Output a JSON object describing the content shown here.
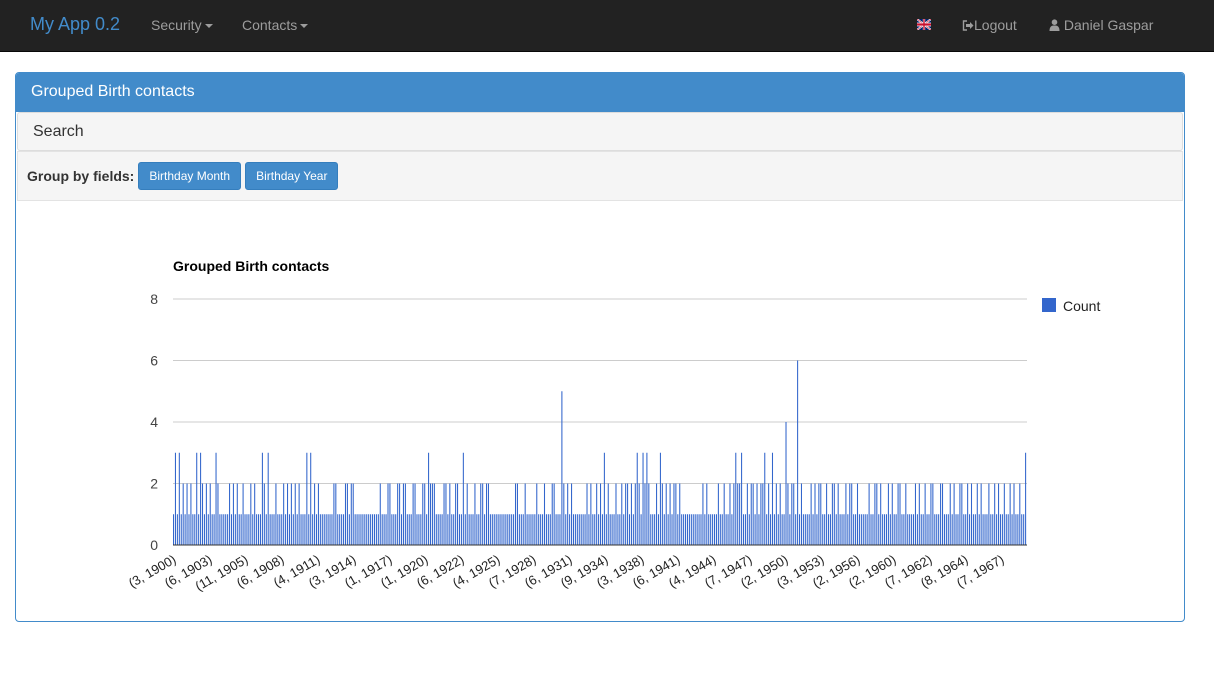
{
  "navbar": {
    "brand": "My App 0.2",
    "menus": [
      {
        "label": "Security"
      },
      {
        "label": "Contacts"
      }
    ],
    "language_icon": "uk-flag-icon",
    "logout_label": "Logout",
    "user_label": "Daniel Gaspar"
  },
  "panel": {
    "title": "Grouped Birth contacts",
    "search_label": "Search",
    "group_by_label": "Group by fields:",
    "group_buttons": [
      {
        "label": "Birthday Month"
      },
      {
        "label": "Birthday Year"
      }
    ]
  },
  "chart_data": {
    "type": "bar",
    "title": "Grouped Birth contacts",
    "xlabel": "",
    "ylabel": "",
    "ylim": [
      0,
      8
    ],
    "yticks": [
      0,
      2,
      4,
      6,
      8
    ],
    "grid": true,
    "legend_position": "right",
    "bar_color": "#3366cc",
    "series": [
      {
        "name": "Count",
        "color": "#3366cc"
      }
    ],
    "xtick_labels": [
      "(3, 1900)",
      "(6, 1903)",
      "(11, 1905)",
      "(6, 1908)",
      "(4, 1911)",
      "(3, 1914)",
      "(1, 1917)",
      "(1, 1920)",
      "(6, 1922)",
      "(4, 1925)",
      "(7, 1928)",
      "(6, 1931)",
      "(9, 1934)",
      "(3, 1938)",
      "(6, 1941)",
      "(4, 1944)",
      "(7, 1947)",
      "(2, 1950)",
      "(3, 1953)",
      "(2, 1956)",
      "(2, 1960)",
      "(7, 1962)",
      "(8, 1964)",
      "(7, 1967)"
    ],
    "values": [
      1,
      3,
      1,
      3,
      1,
      2,
      1,
      2,
      1,
      2,
      1,
      1,
      3,
      1,
      3,
      2,
      1,
      2,
      1,
      2,
      1,
      1,
      3,
      2,
      1,
      1,
      1,
      1,
      1,
      2,
      1,
      2,
      1,
      2,
      1,
      1,
      2,
      1,
      1,
      1,
      2,
      1,
      2,
      1,
      1,
      1,
      3,
      2,
      1,
      3,
      1,
      1,
      1,
      2,
      1,
      1,
      1,
      2,
      1,
      2,
      1,
      2,
      1,
      2,
      1,
      2,
      1,
      1,
      1,
      3,
      1,
      3,
      1,
      2,
      1,
      2,
      1,
      1,
      1,
      1,
      1,
      1,
      1,
      2,
      2,
      1,
      1,
      1,
      1,
      2,
      2,
      1,
      2,
      2,
      1,
      1,
      1,
      1,
      1,
      1,
      1,
      1,
      1,
      1,
      1,
      1,
      1,
      2,
      1,
      1,
      1,
      2,
      2,
      1,
      1,
      1,
      2,
      2,
      1,
      2,
      2,
      1,
      1,
      1,
      2,
      2,
      1,
      1,
      1,
      2,
      2,
      1,
      3,
      2,
      2,
      2,
      1,
      1,
      1,
      1,
      2,
      2,
      1,
      2,
      1,
      1,
      2,
      2,
      1,
      1,
      3,
      1,
      2,
      1,
      1,
      1,
      2,
      1,
      1,
      2,
      2,
      1,
      2,
      2,
      1,
      1,
      1,
      1,
      1,
      1,
      1,
      1,
      1,
      1,
      1,
      1,
      1,
      2,
      2,
      1,
      1,
      1,
      2,
      1,
      1,
      1,
      1,
      1,
      2,
      1,
      1,
      1,
      2,
      1,
      1,
      1,
      2,
      2,
      1,
      1,
      1,
      5,
      2,
      1,
      2,
      1,
      2,
      1,
      1,
      1,
      1,
      1,
      1,
      1,
      2,
      1,
      2,
      1,
      1,
      2,
      1,
      2,
      1,
      3,
      1,
      2,
      1,
      1,
      1,
      2,
      1,
      1,
      2,
      1,
      2,
      2,
      1,
      2,
      1,
      2,
      3,
      2,
      1,
      3,
      2,
      3,
      2,
      1,
      1,
      1,
      2,
      1,
      3,
      2,
      1,
      2,
      1,
      2,
      1,
      2,
      2,
      1,
      2,
      1,
      1,
      1,
      1,
      1,
      1,
      1,
      1,
      1,
      1,
      1,
      2,
      1,
      2,
      1,
      1,
      1,
      1,
      1,
      2,
      1,
      1,
      2,
      1,
      1,
      2,
      1,
      2,
      3,
      2,
      2,
      3,
      1,
      1,
      2,
      1,
      2,
      2,
      1,
      2,
      1,
      2,
      2,
      3,
      1,
      2,
      1,
      3,
      1,
      2,
      1,
      2,
      1,
      1,
      4,
      2,
      1,
      2,
      2,
      1,
      6,
      1,
      2,
      1,
      1,
      1,
      1,
      2,
      1,
      2,
      1,
      2,
      2,
      1,
      1,
      2,
      1,
      1,
      2,
      2,
      1,
      2,
      1,
      1,
      1,
      2,
      1,
      2,
      2,
      1,
      1,
      2,
      1,
      1,
      1,
      1,
      1,
      2,
      1,
      1,
      2,
      2,
      1,
      2,
      1,
      1,
      1,
      2,
      1,
      2,
      1,
      1,
      2,
      2,
      1,
      1,
      2,
      1,
      1,
      1,
      1,
      2,
      1,
      2,
      1,
      1,
      2,
      1,
      1,
      2,
      2,
      1,
      1,
      1,
      2,
      2,
      1,
      1,
      1,
      2,
      1,
      2,
      1,
      1,
      2,
      2,
      1,
      1,
      2,
      1,
      2,
      1,
      1,
      2,
      1,
      2,
      1,
      1,
      1,
      2,
      1,
      1,
      2,
      1,
      2,
      1,
      1,
      2,
      1,
      1,
      2,
      1,
      2,
      1,
      1,
      2,
      1,
      1,
      3
    ]
  }
}
